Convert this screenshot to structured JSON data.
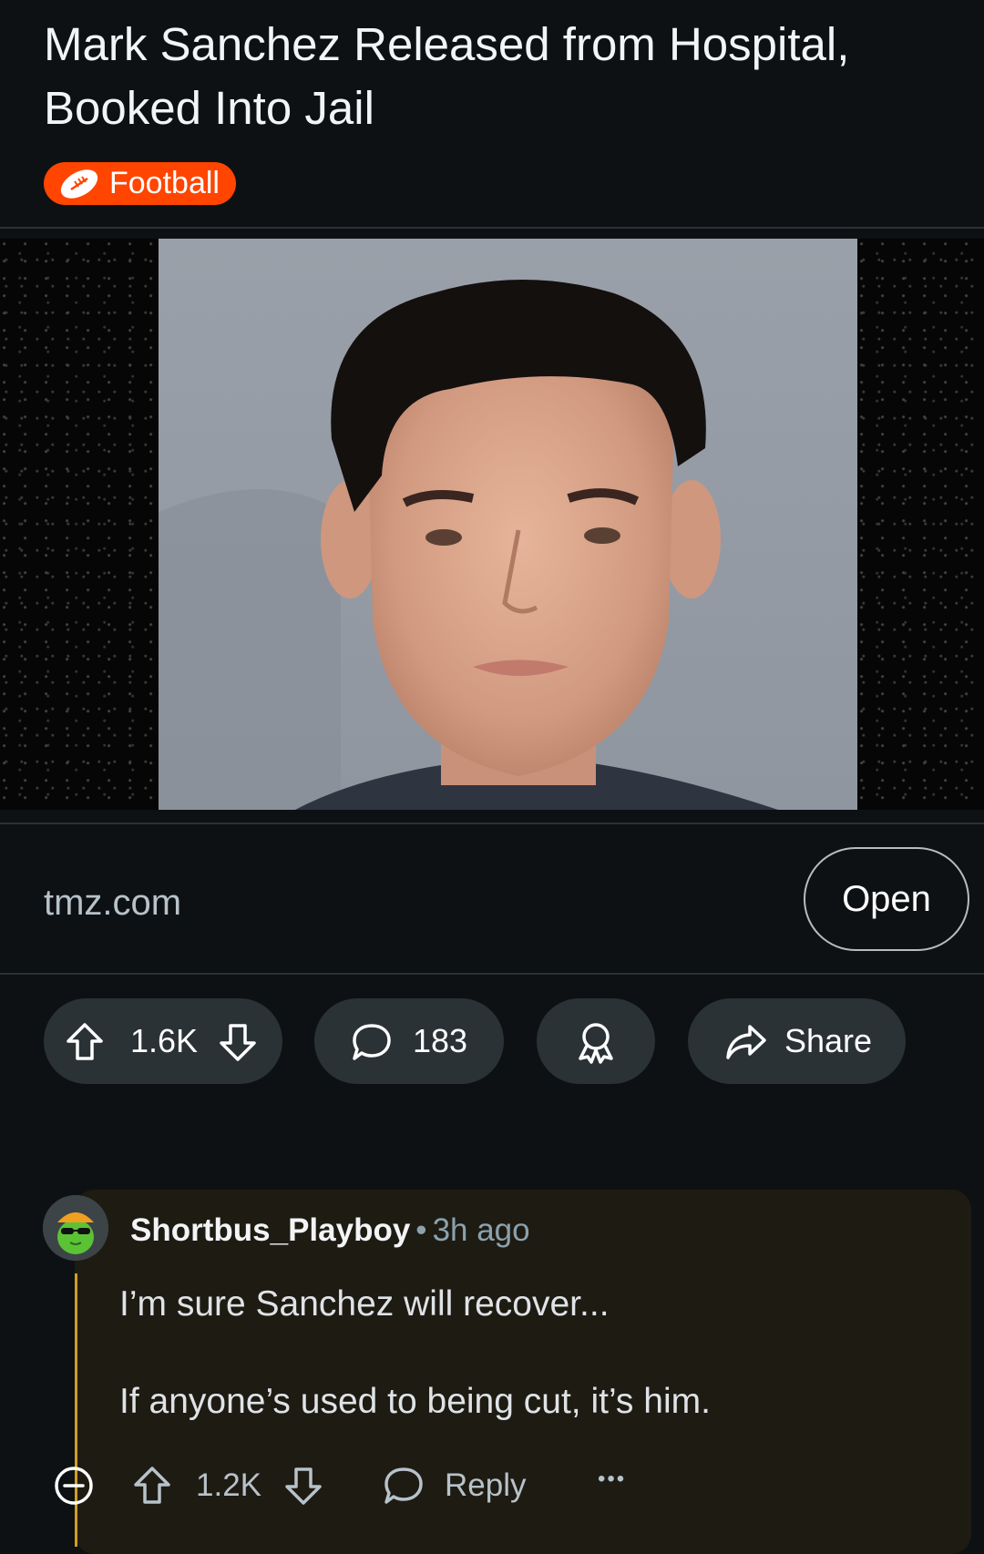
{
  "post": {
    "title": "Mark Sanchez Released from Hospital, Booked Into Jail",
    "flair": "Football",
    "link_domain": "tmz.com",
    "open_label": "Open",
    "vote_count": "1.6K",
    "comment_count": "183",
    "share_label": "Share"
  },
  "comment": {
    "username": "Shortbus_Playboy",
    "separator": "•",
    "time": "3h ago",
    "paragraphs": [
      "I’m sure Sanchez will recover...",
      "If anyone’s used to being cut, it’s him."
    ],
    "vote_count": "1.2K",
    "reply_label": "Reply",
    "more_label": "•••"
  },
  "icons": {
    "flair": "football-icon",
    "upvote": "arrow-up-icon",
    "downvote": "arrow-down-icon",
    "comments": "comment-bubble-icon",
    "award": "award-icon",
    "share": "share-arrow-icon",
    "collapse": "collapse-minus-icon",
    "reply": "reply-bubble-icon"
  },
  "colors": {
    "background": "#0e1113",
    "flair": "#ff4500",
    "pill": "#2a3236",
    "comment_highlight": "#1e1b13",
    "thread_line": "#d29d22"
  }
}
